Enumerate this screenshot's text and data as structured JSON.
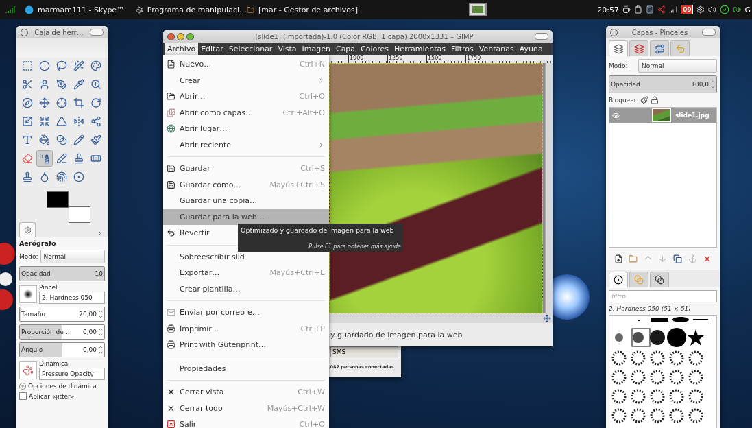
{
  "taskbar": {
    "tasks": [
      {
        "label": "marmam111 - Skype™"
      },
      {
        "label": "Programa de manipulaci…"
      },
      {
        "label": "[mar - Gestor de archivos]"
      }
    ],
    "clock": "20:57",
    "calendar_day": "09",
    "edge_label": "G"
  },
  "toolbox": {
    "title": "Caja de herr…",
    "tools": [
      {
        "selected": false
      },
      {
        "selected": false
      },
      {
        "selected": false
      },
      {
        "selected": false
      },
      {
        "selected": false
      },
      {
        "selected": false
      },
      {
        "selected": false
      },
      {
        "selected": false
      },
      {
        "selected": false
      },
      {
        "selected": false
      },
      {
        "selected": false
      },
      {
        "selected": false
      },
      {
        "selected": false
      },
      {
        "selected": false
      },
      {
        "selected": false
      },
      {
        "selected": false
      },
      {
        "selected": false
      },
      {
        "selected": false
      },
      {
        "selected": false
      },
      {
        "selected": false
      },
      {
        "selected": false
      },
      {
        "selected": false
      },
      {
        "selected": false
      },
      {
        "selected": false
      },
      {
        "selected": false
      },
      {
        "selected": false
      },
      {
        "selected": true
      },
      {
        "selected": false
      },
      {
        "selected": false
      },
      {
        "selected": false
      },
      {
        "selected": false
      },
      {
        "selected": false
      },
      {
        "selected": false
      },
      {
        "selected": false
      }
    ],
    "options": {
      "tool_name": "Aerógrafo",
      "mode_label": "Modo:",
      "mode": "Normal",
      "opacity": {
        "label": "Opacidad",
        "value": "10",
        "level": 1
      },
      "brush_label": "Pincel",
      "brush": "2. Hardness 050",
      "sliders": [
        {
          "label": "Tamaño",
          "value": "20,00",
          "level": 0.02
        },
        {
          "label": "Proporción de …",
          "value": "0,00",
          "level": 0.5
        },
        {
          "label": "Ángulo",
          "value": "0,00",
          "level": 0.5
        }
      ],
      "dynamics_label": "Dinámica",
      "dynamics": "Pressure Opacity",
      "dynamics_options": {
        "label": "Opciones de dinámica",
        "expanded": false
      },
      "jitter": {
        "label": "Aplicar «jitter»",
        "checked": false
      }
    }
  },
  "image_window": {
    "title": "[slide1] (importada)-1.0 (Color RGB, 1 capa) 2000x1331 – GIMP",
    "menus": [
      {
        "label": "Archivo",
        "selected": true
      },
      {
        "label": "Editar",
        "selected": false
      },
      {
        "label": "Seleccionar",
        "selected": false
      },
      {
        "label": "Vista",
        "selected": false
      },
      {
        "label": "Imagen",
        "selected": false
      },
      {
        "label": "Capa",
        "selected": false
      },
      {
        "label": "Colores",
        "selected": false
      },
      {
        "label": "Herramientas",
        "selected": false
      },
      {
        "label": "Filtros",
        "selected": false
      },
      {
        "label": "Ventanas",
        "selected": false
      },
      {
        "label": "Ayuda",
        "selected": false
      }
    ],
    "ruler_marks": [
      "1000",
      "1250",
      "1500",
      "1750"
    ],
    "status": "y guardado de imagen para la web"
  },
  "file_menu": {
    "items": [
      {
        "kind": "item",
        "label": "Nuevo…",
        "shortcut": "Ctrl+N",
        "selected": false
      },
      {
        "kind": "submenu",
        "label": "Crear",
        "selected": false
      },
      {
        "kind": "item",
        "label": "Abrir…",
        "shortcut": "Ctrl+O",
        "selected": false
      },
      {
        "kind": "item",
        "label": "Abrir como capas…",
        "shortcut": "Ctrl+Alt+O",
        "selected": false
      },
      {
        "kind": "item",
        "label": "Abrir lugar…",
        "selected": false
      },
      {
        "kind": "submenu",
        "label": "Abrir reciente",
        "selected": false
      },
      {
        "kind": "separator"
      },
      {
        "kind": "item",
        "label": "Guardar",
        "shortcut": "Ctrl+S",
        "selected": false
      },
      {
        "kind": "item",
        "label": "Guardar como…",
        "shortcut": "Mayús+Ctrl+S",
        "selected": false
      },
      {
        "kind": "item",
        "label": "Guardar una copia…",
        "selected": false
      },
      {
        "kind": "item",
        "label": "Guardar para la web…",
        "selected": true
      },
      {
        "kind": "item",
        "label": "Revertir",
        "selected": false
      },
      {
        "kind": "separator"
      },
      {
        "kind": "item",
        "label": "Sobreescribir slid",
        "selected": false
      },
      {
        "kind": "item",
        "label": "Exportar…",
        "shortcut": "Mayús+Ctrl+E",
        "selected": false
      },
      {
        "kind": "item",
        "label": "Crear plantilla…",
        "selected": false
      },
      {
        "kind": "separator"
      },
      {
        "kind": "item",
        "label": "Enviar por correo-e…",
        "selected": false
      },
      {
        "kind": "item",
        "label": "Imprimir…",
        "shortcut": "Ctrl+P",
        "selected": false
      },
      {
        "kind": "item",
        "label": "Print with Gutenprint…",
        "selected": false
      },
      {
        "kind": "separator"
      },
      {
        "kind": "item",
        "label": "Propiedades",
        "selected": false
      },
      {
        "kind": "separator"
      },
      {
        "kind": "item",
        "label": "Cerrar vista",
        "shortcut": "Ctrl+W",
        "selected": false
      },
      {
        "kind": "item",
        "label": "Cerrar todo",
        "shortcut": "Mayús+Ctrl+W",
        "selected": false
      },
      {
        "kind": "item",
        "label": "Salir",
        "shortcut": "Ctrl+Q",
        "selected": false
      }
    ]
  },
  "tooltip": {
    "text": "Optimizado y guardado de imagen para la web",
    "hint": "Pulse F1 para obtener más ayuda"
  },
  "chat_window": {
    "tab": "SMS",
    "status": ",087 personas conectadas"
  },
  "dock": {
    "title": "Capas - Pinceles",
    "tabs": [
      {
        "selected": true
      },
      {
        "selected": false
      },
      {
        "selected": false
      },
      {
        "selected": false
      }
    ],
    "mode_label": "Modo:",
    "mode": "Normal",
    "opacity": {
      "label": "Opacidad",
      "value": "100,0",
      "level": 1
    },
    "lock_label": "Bloquear:",
    "layers": [
      {
        "name": "slide1.jpg",
        "selected": true,
        "visible": true
      }
    ],
    "brush_tabs": [
      {
        "selected": true
      },
      {
        "selected": false
      },
      {
        "selected": false
      }
    ],
    "filter_placeholder": "filtro",
    "brush_name": "2. Hardness 050 (51 × 51)"
  }
}
